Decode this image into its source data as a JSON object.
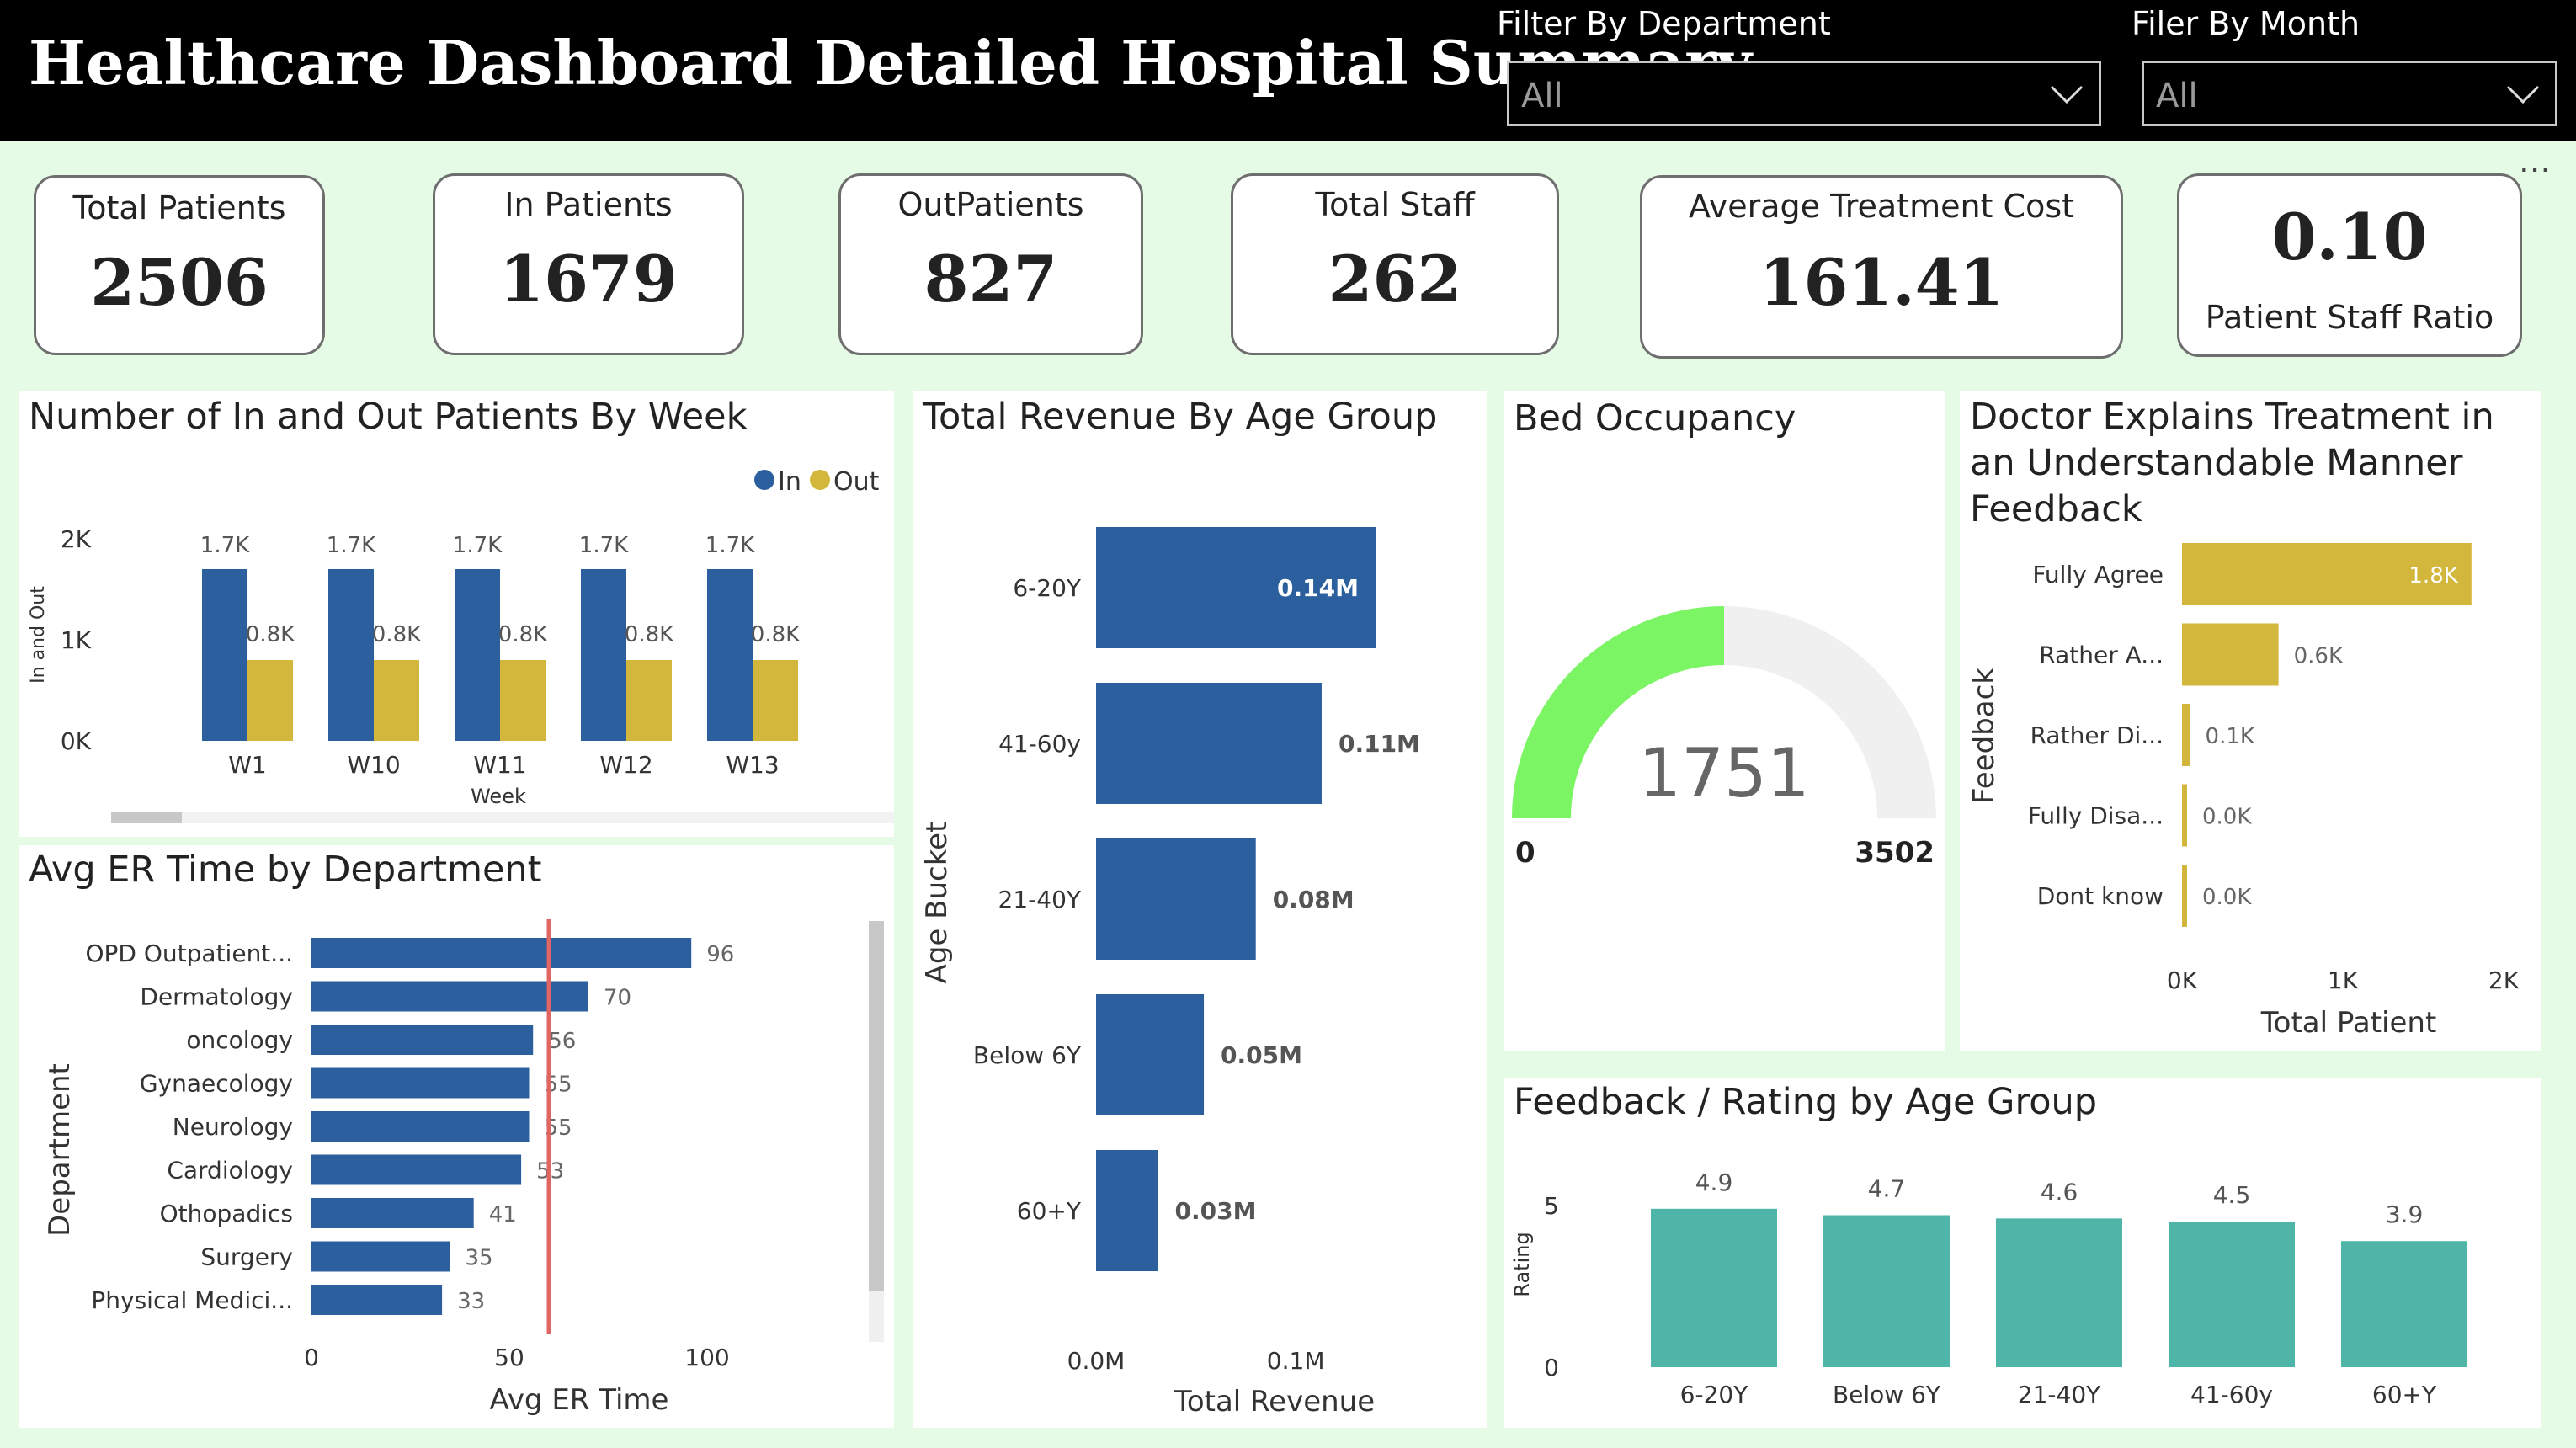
{
  "header": {
    "title": "Healthcare Dashboard Detailed Hospital Summary",
    "filter_department": {
      "label": "Filter By Department",
      "value": "All"
    },
    "filter_month": {
      "label": "Filer By Month",
      "value": "All"
    },
    "more_options": "..."
  },
  "kpis": {
    "total_patients": {
      "label": "Total Patients",
      "value": "2506"
    },
    "in_patients": {
      "label": "In Patients",
      "value": "1679"
    },
    "out_patients": {
      "label": "OutPatients",
      "value": "827"
    },
    "total_staff": {
      "label": "Total Staff",
      "value": "262"
    },
    "avg_treatment_cost": {
      "label": "Average Treatment Cost",
      "value": "161.41"
    },
    "patient_staff_ratio": {
      "label": "Patient Staff Ratio",
      "value": "0.10"
    }
  },
  "colors": {
    "in": "#2c5f9e",
    "out": "#d3b73c",
    "gauge_fill": "#7cf564",
    "gauge_bg": "#f0f0f0",
    "rating": "#4fb5a8",
    "avg_line": "#e06666"
  },
  "chart_data": [
    {
      "id": "weekly",
      "type": "bar",
      "title": "Number of In and Out Patients By Week",
      "xlabel": "Week",
      "ylabel": "In and Out",
      "categories": [
        "W1",
        "W10",
        "W11",
        "W12",
        "W13"
      ],
      "series": [
        {
          "name": "In",
          "values": [
            1.7,
            1.7,
            1.7,
            1.7,
            1.7
          ],
          "labels": [
            "1.7K",
            "1.7K",
            "1.7K",
            "1.7K",
            "1.7K"
          ]
        },
        {
          "name": "Out",
          "values": [
            0.8,
            0.8,
            0.8,
            0.8,
            0.8
          ],
          "labels": [
            "0.8K",
            "0.8K",
            "0.8K",
            "0.8K",
            "0.8K"
          ]
        }
      ],
      "yticks": [
        "0K",
        "1K",
        "2K"
      ],
      "ylim": [
        0,
        2
      ],
      "legend": "top-right",
      "grid": false
    },
    {
      "id": "er_time",
      "type": "bar",
      "orientation": "horizontal",
      "title": "Avg ER Time by Department",
      "xlabel": "Avg ER Time",
      "ylabel": "Department",
      "categories": [
        "OPD Outpatient...",
        "Dermatology",
        "oncology",
        "Gynaecology",
        "Neurology",
        "Cardiology",
        "Othopadics",
        "Surgery",
        "Physical Medici..."
      ],
      "values": [
        96,
        70,
        56,
        55,
        55,
        53,
        41,
        35,
        33
      ],
      "average_line": 60,
      "xticks": [
        "0",
        "50",
        "100"
      ],
      "xlim": [
        0,
        100
      ]
    },
    {
      "id": "revenue",
      "type": "bar",
      "orientation": "horizontal",
      "title": "Total Revenue By Age Group",
      "xlabel": "Total Revenue",
      "ylabel": "Age Bucket",
      "categories": [
        "6-20Y",
        "41-60y",
        "21-40Y",
        "Below 6Y",
        "60+Y"
      ],
      "values": [
        0.14,
        0.113,
        0.08,
        0.054,
        0.031
      ],
      "labels": [
        "0.14M",
        "0.11M",
        "0.08M",
        "0.05M",
        "0.03M"
      ],
      "xticks": [
        "0.0M",
        "0.1M"
      ],
      "xlim": [
        0,
        0.14
      ]
    },
    {
      "id": "bed_occupancy",
      "type": "gauge",
      "title": "Bed Occupancy",
      "value": 1751,
      "min": 0,
      "max": 3502,
      "value_label": "1751",
      "min_label": "0",
      "max_label": "3502"
    },
    {
      "id": "doctor_feedback",
      "type": "bar",
      "orientation": "horizontal",
      "title": "Doctor Explains Treatment in an Understandable Manner Feedback",
      "xlabel": "Total Patient",
      "ylabel": "Feedback",
      "categories": [
        "Fully Agree",
        "Rather A...",
        "Rather Di...",
        "Fully Disa...",
        "Dont know"
      ],
      "values": [
        1.8,
        0.6,
        0.05,
        0.02,
        0.02
      ],
      "labels": [
        "1.8K",
        "0.6K",
        "0.1K",
        "0.0K",
        "0.0K"
      ],
      "xticks": [
        "0K",
        "1K",
        "2K"
      ],
      "xlim": [
        0,
        2
      ]
    },
    {
      "id": "rating",
      "type": "bar",
      "title": "Feedback / Rating by Age Group",
      "ylabel": "Rating",
      "categories": [
        "6-20Y",
        "Below 6Y",
        "21-40Y",
        "41-60y",
        "60+Y"
      ],
      "values": [
        4.9,
        4.7,
        4.6,
        4.5,
        3.9
      ],
      "labels": [
        "4.9",
        "4.7",
        "4.6",
        "4.5",
        "3.9"
      ],
      "yticks": [
        "0",
        "5"
      ],
      "ylim": [
        0,
        5
      ]
    }
  ]
}
